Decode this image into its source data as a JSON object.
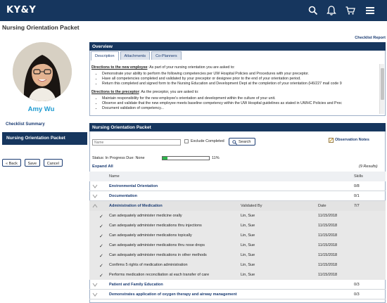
{
  "app": {
    "brand": "KY&Y",
    "page_title": "Nursing Orientation Packet",
    "checklist_report": "Checklist Report"
  },
  "icons": [
    "search-icon",
    "bell-icon",
    "cart-icon",
    "menu-icon"
  ],
  "colors": {
    "nav": "#16365e",
    "accent": "#1f9bd1",
    "progress": "#2db34a"
  },
  "user": {
    "name": "Amy Wu"
  },
  "sidebar": {
    "summary_label": "Checklist Summary",
    "active_item": "Nursing Orientation Packet"
  },
  "buttons": {
    "back": "« Back",
    "save": "Save",
    "cancel": "Cancel"
  },
  "overview": {
    "title": "Overview",
    "tabs": [
      "Description",
      "Attachments",
      "Co-Planners"
    ],
    "new_employee_heading": "Directions to the new employee",
    "new_employee_intro": ": As part of your nursing orientation you are asked to:",
    "new_employee_items": [
      "Demonstrate your ability to perform the following competencies per UW Hospital Policies and Procedures with your preceptor.",
      "Have all competencies completed and validated by your preceptor or designee prior to the end of your orientation period.",
      "Return this completed and signed form to the Nursing Education and Development Dept at the completion of your orientation (H6/227 mail code 9"
    ],
    "preceptor_heading": "Directions to the preceptor",
    "preceptor_intro": ": As the preceptor, you are asked to:",
    "preceptor_items": [
      "Maintain responsibility for the new employee's orientation and development within the culture of your unit.",
      "Observe and validate that the new employee meets baseline competency within the UW Hospital guidelines as stated in UWHC Policies and Proc",
      "Document validation of competency..."
    ]
  },
  "packet": {
    "title": "Nursing Orientation Packet",
    "filter_placeholder": "Name",
    "exclude_label": "Exclude Completed",
    "search_label": "Search",
    "observation_notes": "Observation Notes",
    "status_text": "Status: In Progress   Due: None",
    "progress_percent": 11,
    "progress_label": "11%",
    "expand_all": "Expand All",
    "results": "(9 Results)",
    "columns": {
      "name": "Name",
      "validated_by": "Validated By",
      "date": "Date",
      "skills": "Skills"
    },
    "rows": [
      {
        "type": "group",
        "name": "Environmental Orientation",
        "skills": "0/8"
      },
      {
        "type": "group",
        "name": "Documentation",
        "skills": "0/1"
      },
      {
        "type": "open",
        "name": "Administration of Medication",
        "validated_by": "Validated By",
        "date": "Date",
        "skills": "7/7"
      },
      {
        "type": "item",
        "name": "Can adequately administer medicine orally",
        "validated_by": "Lin, Sue",
        "date": "11/15/2018"
      },
      {
        "type": "item",
        "name": "Can adequately administer medications thru injections",
        "validated_by": "Lin, Sue",
        "date": "11/15/2018"
      },
      {
        "type": "item",
        "name": "Can adequately administer medications topically",
        "validated_by": "Lin, Sue",
        "date": "11/15/2018"
      },
      {
        "type": "item",
        "name": "Can adequately administer medications thru nose drops",
        "validated_by": "Lin, Sue",
        "date": "11/15/2018"
      },
      {
        "type": "item",
        "name": "Can adequately administer medications in other methods",
        "validated_by": "Lin, Sue",
        "date": "11/15/2018"
      },
      {
        "type": "item",
        "name": "Confirms 5 rights of medication administration",
        "validated_by": "Lin, Sue",
        "date": "11/15/2018"
      },
      {
        "type": "item",
        "name": "Performs medication reconciliation at each transfer of care",
        "validated_by": "Lin, Sue",
        "date": "11/15/2018"
      },
      {
        "type": "group",
        "name": "Patient and Family Education",
        "skills": "0/3"
      },
      {
        "type": "group",
        "name": "Demonstrates application of oxygen therapy and airway management",
        "skills": "0/3"
      }
    ]
  }
}
